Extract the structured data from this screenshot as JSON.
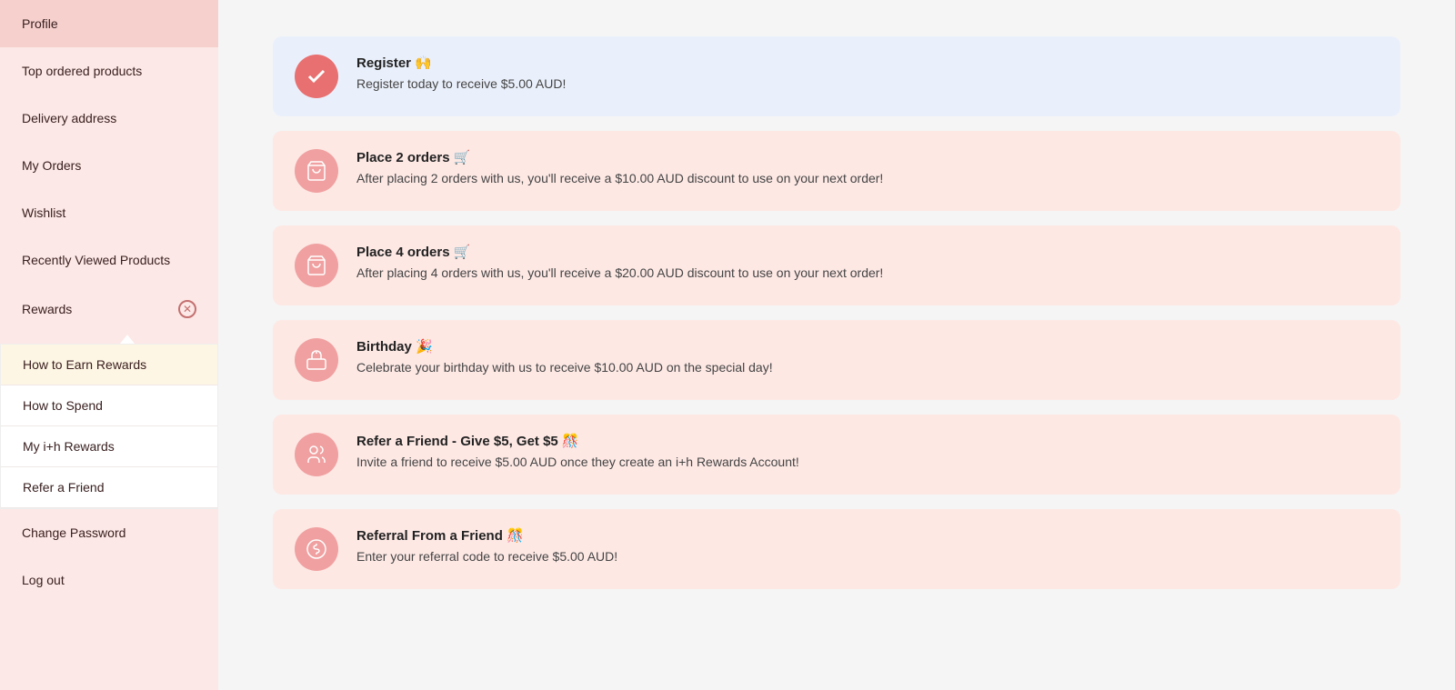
{
  "sidebar": {
    "items": [
      {
        "label": "Profile",
        "key": "profile"
      },
      {
        "label": "Top ordered products",
        "key": "top-ordered"
      },
      {
        "label": "Delivery address",
        "key": "delivery"
      },
      {
        "label": "My Orders",
        "key": "orders"
      },
      {
        "label": "Wishlist",
        "key": "wishlist"
      },
      {
        "label": "Recently Viewed Products",
        "key": "recently-viewed"
      },
      {
        "label": "Rewards",
        "key": "rewards"
      },
      {
        "label": "Change Password",
        "key": "change-password"
      },
      {
        "label": "Log out",
        "key": "logout"
      }
    ],
    "submenu": {
      "items": [
        {
          "label": "How to Earn Rewards",
          "key": "earn",
          "highlighted": true
        },
        {
          "label": "How to Spend",
          "key": "spend"
        },
        {
          "label": "My i+h Rewards",
          "key": "my-rewards"
        },
        {
          "label": "Refer a Friend",
          "key": "refer"
        }
      ]
    }
  },
  "rewards": {
    "cards": [
      {
        "key": "register",
        "style": "completed",
        "icon": "check",
        "title": "Register 🙌",
        "description": "Register today to receive $5.00 AUD!"
      },
      {
        "key": "place-2-orders",
        "style": "pink",
        "icon": "cart",
        "title": "Place 2 orders 🛒",
        "description": "After placing 2 orders with us, you'll receive a $10.00 AUD discount to use on your next order!"
      },
      {
        "key": "place-4-orders",
        "style": "pink",
        "icon": "cart",
        "title": "Place 4 orders 🛒",
        "description": "After placing 4 orders with us, you'll receive a $20.00 AUD discount to use on your next order!"
      },
      {
        "key": "birthday",
        "style": "pink",
        "icon": "birthday",
        "title": "Birthday 🎉",
        "description": "Celebrate your birthday with us to receive $10.00 AUD on the special day!"
      },
      {
        "key": "refer-friend",
        "style": "pink",
        "icon": "refer",
        "title": "Refer a Friend - Give $5, Get $5 🎊",
        "description": "Invite a friend to receive $5.00 AUD once they create an i+h Rewards Account!"
      },
      {
        "key": "referral-from-friend",
        "style": "pink",
        "icon": "gift",
        "title": "Referral From a Friend 🎊",
        "description": "Enter your referral code to receive $5.00 AUD!"
      }
    ]
  }
}
